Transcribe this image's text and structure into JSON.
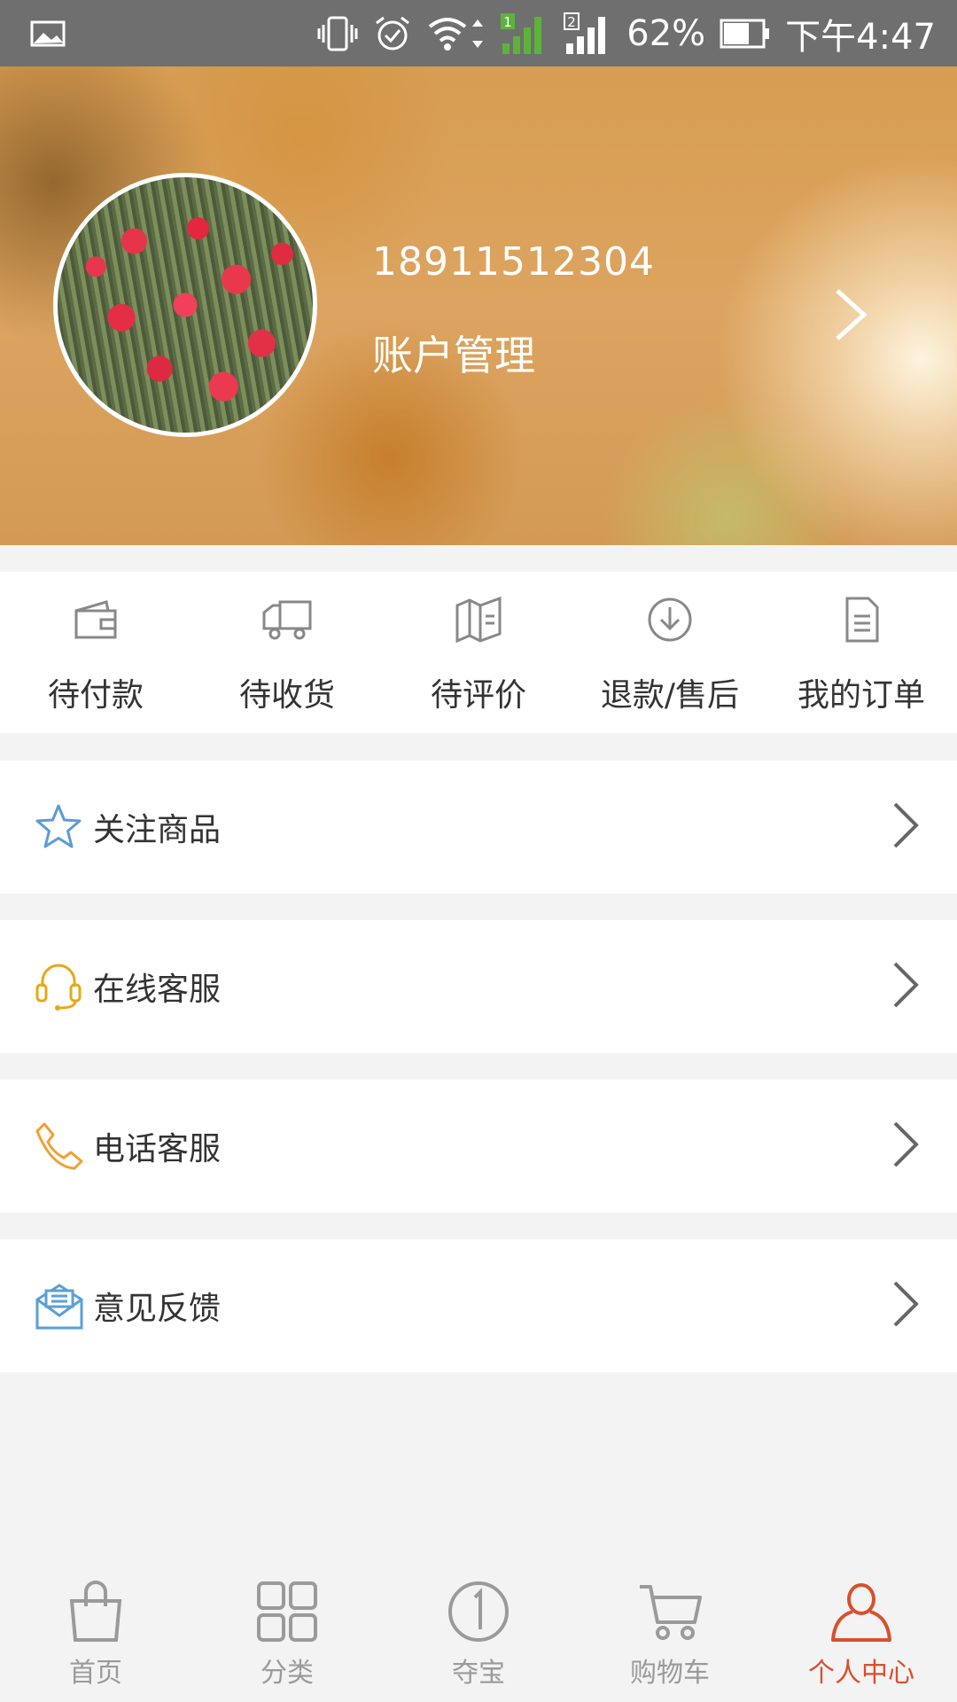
{
  "status_bar": {
    "battery": "62%",
    "time": "下午4:47",
    "sim1": "1",
    "sim2": "2"
  },
  "profile": {
    "phone": "18911512304",
    "account_label": "账户管理"
  },
  "orders": [
    {
      "label": "待付款",
      "icon": "wallet-icon"
    },
    {
      "label": "待收货",
      "icon": "truck-icon"
    },
    {
      "label": "待评价",
      "icon": "map-icon"
    },
    {
      "label": "退款/售后",
      "icon": "download-circle-icon"
    },
    {
      "label": "我的订单",
      "icon": "document-icon"
    }
  ],
  "menu": [
    {
      "label": "关注商品",
      "icon": "star-icon"
    },
    {
      "label": "在线客服",
      "icon": "headset-icon"
    },
    {
      "label": "电话客服",
      "icon": "phone-icon"
    },
    {
      "label": "意见反馈",
      "icon": "mail-icon"
    }
  ],
  "bottom_nav": [
    {
      "label": "首页",
      "icon": "shopping-bag-icon",
      "active": false
    },
    {
      "label": "分类",
      "icon": "grid-icon",
      "active": false
    },
    {
      "label": "夺宝",
      "icon": "treasure-icon",
      "active": false
    },
    {
      "label": "购物车",
      "icon": "cart-icon",
      "active": false
    },
    {
      "label": "个人中心",
      "icon": "person-icon",
      "active": true
    }
  ],
  "colors": {
    "accent": "#d9502d",
    "nav_inactive": "#9a9a9a",
    "star": "#5b9bd5",
    "headset": "#e6a817",
    "phone": "#f0a030",
    "mail": "#5aa0d8"
  }
}
